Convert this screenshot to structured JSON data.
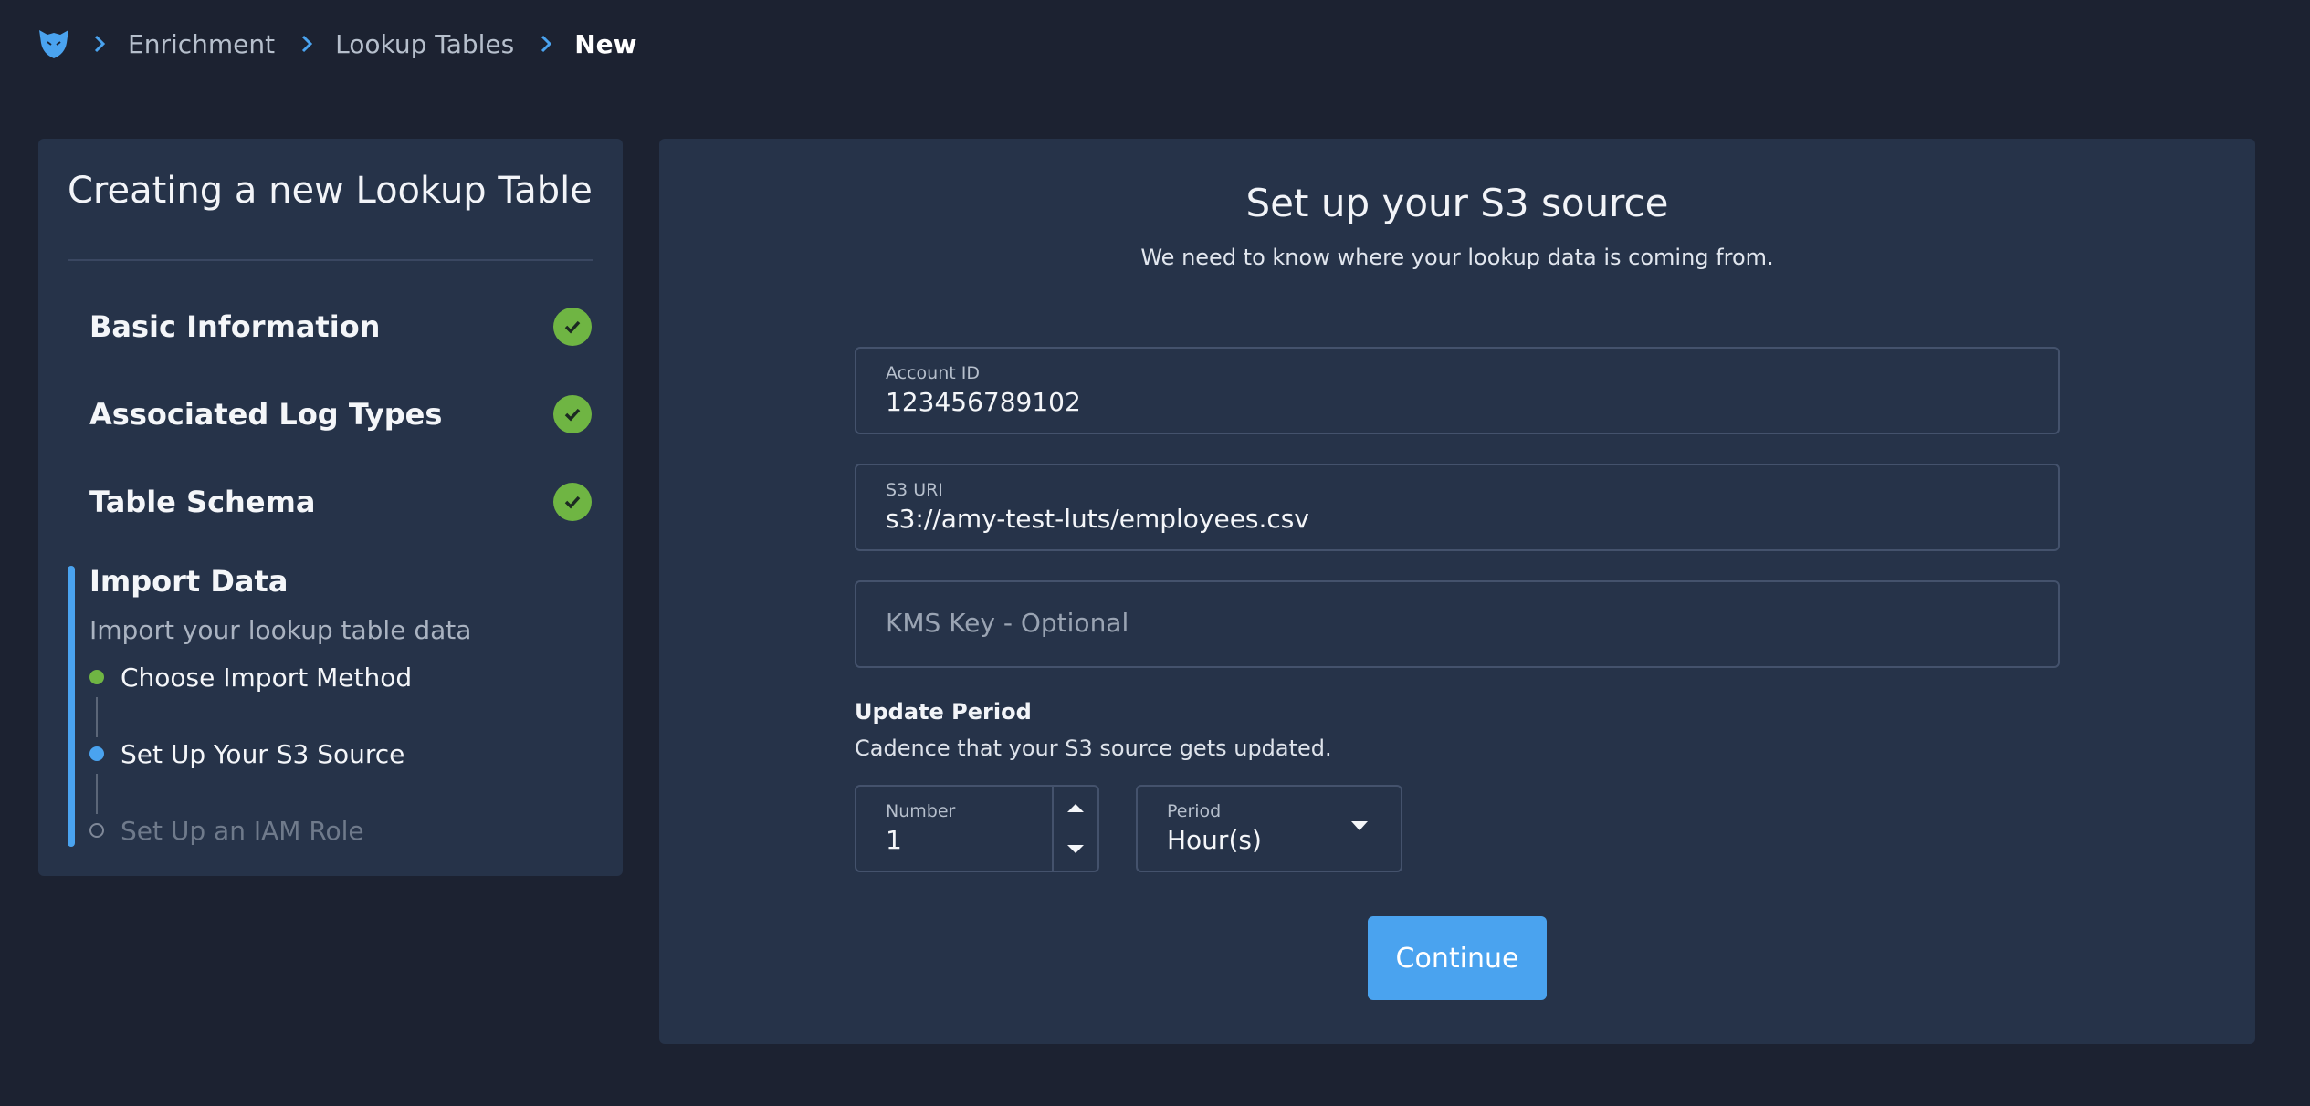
{
  "breadcrumb": {
    "items": [
      "Enrichment",
      "Lookup Tables"
    ],
    "current": "New"
  },
  "sidebar": {
    "title": "Creating a new Lookup Table",
    "completed_steps": [
      "Basic Information",
      "Associated Log Types",
      "Table Schema"
    ],
    "active_step": {
      "title": "Import Data",
      "subtitle": "Import your lookup table data",
      "substeps": [
        {
          "label": "Choose Import Method",
          "state": "done"
        },
        {
          "label": "Set Up Your S3 Source",
          "state": "current"
        },
        {
          "label": "Set Up an IAM Role",
          "state": "pending"
        }
      ]
    }
  },
  "main": {
    "title": "Set up your S3 source",
    "subtitle": "We need to know where your lookup data is coming from.",
    "account_id": {
      "label": "Account ID",
      "value": "123456789102"
    },
    "s3_uri": {
      "label": "S3 URI",
      "value": "s3://amy-test-luts/employees.csv"
    },
    "kms_key": {
      "placeholder": "KMS Key - Optional"
    },
    "update_period": {
      "label": "Update Period",
      "description": "Cadence that your S3 source gets updated.",
      "number": {
        "label": "Number",
        "value": "1"
      },
      "period": {
        "label": "Period",
        "value": "Hour(s)"
      }
    },
    "continue_label": "Continue"
  },
  "colors": {
    "background": "#1c2231",
    "panel": "#263349",
    "accent": "#4aa3ef",
    "success": "#6fb543"
  }
}
